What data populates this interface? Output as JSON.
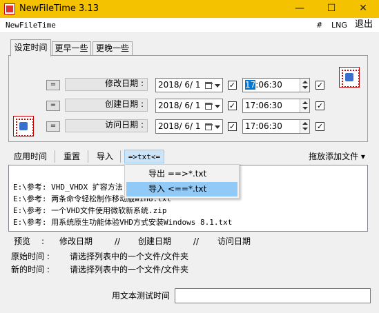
{
  "window": {
    "title": "NewFileTime 3.13",
    "minimize": "—",
    "maximize": "☐",
    "close": "✕"
  },
  "menubar": {
    "app_name": "NewFileTime",
    "hash": "#",
    "lng": "LNG",
    "exit": "退出"
  },
  "tabs": [
    {
      "label": "设定时间",
      "active": true
    },
    {
      "label": "更早一些",
      "active": false
    },
    {
      "label": "更晚一些",
      "active": false
    }
  ],
  "rows": [
    {
      "eq": "=",
      "label": "修改日期 :",
      "date": "2018/ 6/ 1",
      "date_checked": true,
      "time_sel": "17",
      "time_rest": ":06:30",
      "time_checked": true
    },
    {
      "eq": "=",
      "label": "创建日期 :",
      "date": "2018/ 6/ 1",
      "date_checked": true,
      "time_sel": "",
      "time_rest": "17:06:30",
      "time_checked": true
    },
    {
      "eq": "=",
      "label": "访问日期 :",
      "date": "2018/ 6/ 1",
      "date_checked": true,
      "time_sel": "",
      "time_rest": "17:06:30",
      "time_checked": true
    }
  ],
  "toolbar": {
    "apply": "应用时间",
    "reset": "重置",
    "import": "导入",
    "txt": "=>txt<=",
    "drag_add": "拖放添加文件 ▾"
  },
  "dropdown": {
    "export": "导出 ==>*.txt",
    "import": "导入 <==*.txt"
  },
  "list": [
    "E:\\参考: VHD_VHDX 扩容方法.",
    "E:\\参考: 两条命令轻松制作移动版Win8.txt",
    "E:\\参考: 一个VHD文件使用微软新系统.zip",
    "E:\\参考: 用系统原生功能体验VHD方式安装Windows 8.1.txt"
  ],
  "info": {
    "preview": "预览",
    "colon": ":",
    "modify": "修改日期",
    "sep1": "//",
    "create": "创建日期",
    "sep2": "//",
    "access": "访问日期",
    "orig_label": "原始时间 :",
    "orig_value": "请选择列表中的一个文件/文件夹",
    "new_label": "新的时间 :",
    "new_value": "请选择列表中的一个文件/文件夹",
    "test_label": "用文本测试时间"
  }
}
